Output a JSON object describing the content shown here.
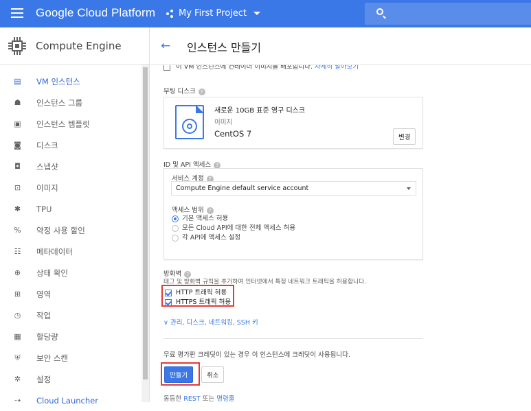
{
  "topbar": {
    "brand": "Google Cloud Platform",
    "project": "My First Project"
  },
  "sidebar": {
    "title": "Compute Engine",
    "items": [
      {
        "label": "VM 인스턴스",
        "icon": "vm-instance-icon",
        "active": true
      },
      {
        "label": "인스턴스 그룹",
        "icon": "instance-group-icon"
      },
      {
        "label": "인스턴스 템플릿",
        "icon": "instance-template-icon"
      },
      {
        "label": "디스크",
        "icon": "disk-icon"
      },
      {
        "label": "스냅샷",
        "icon": "snapshot-icon"
      },
      {
        "label": "이미지",
        "icon": "image-icon"
      },
      {
        "label": "TPU",
        "icon": "tpu-icon"
      },
      {
        "label": "약정 사용 할인",
        "icon": "percent-icon"
      },
      {
        "label": "메타데이터",
        "icon": "metadata-icon"
      },
      {
        "label": "상태 확인",
        "icon": "health-check-icon"
      },
      {
        "label": "영역",
        "icon": "zone-icon"
      },
      {
        "label": "작업",
        "icon": "clock-icon"
      },
      {
        "label": "할당량",
        "icon": "quota-icon"
      },
      {
        "label": "보안 스캔",
        "icon": "shield-icon"
      },
      {
        "label": "설정",
        "icon": "gear-icon"
      },
      {
        "label": "Cloud Launcher",
        "icon": "launcher-icon"
      }
    ]
  },
  "page": {
    "title": "인스턴스 만들기"
  },
  "container_row": {
    "text": "이 VM 인스턴스에 컨테이너 이미지를 배포합니다.",
    "link": "자세히 알아보기"
  },
  "boot_disk": {
    "label": "부팅 디스크",
    "line1": "새로운 10GB 표준 영구 디스크",
    "line2": "이미지",
    "os": "CentOS 7",
    "change": "변경"
  },
  "identity": {
    "label": "ID 및 API 액세스",
    "service_account_label": "서비스 계정",
    "service_account_value": "Compute Engine default service account",
    "scope_label": "액세스 범위",
    "scopes": [
      "기본 액세스 허용",
      "모든 Cloud API에 대한 전체 액세스 허용",
      "각 API에 액세스 설정"
    ],
    "selected_scope": 0
  },
  "firewall": {
    "label": "방화벽",
    "description": "태그 및 방화벽 규칙을 추가하여 인터넷에서 특정 네트워크 트래픽을 허용합니다.",
    "http": "HTTP 트래픽 허용",
    "https": "HTTPS 트래픽 허용",
    "http_checked": true,
    "https_checked": true
  },
  "more_link": "관리, 디스크, 네트워킹, SSH 키",
  "credit_note": "무료 평가판 크레딧이 있는 경우 이 인스턴스에 크레딧이 사용됩니다.",
  "buttons": {
    "create": "만들기",
    "cancel": "취소"
  },
  "footer": {
    "prefix": "동등한",
    "rest": "REST",
    "or": "또는",
    "cmd": "명령줄"
  },
  "colors": {
    "topbar": "#3b78e7",
    "accent": "#3367d6",
    "highlight_box": "#e53935"
  }
}
